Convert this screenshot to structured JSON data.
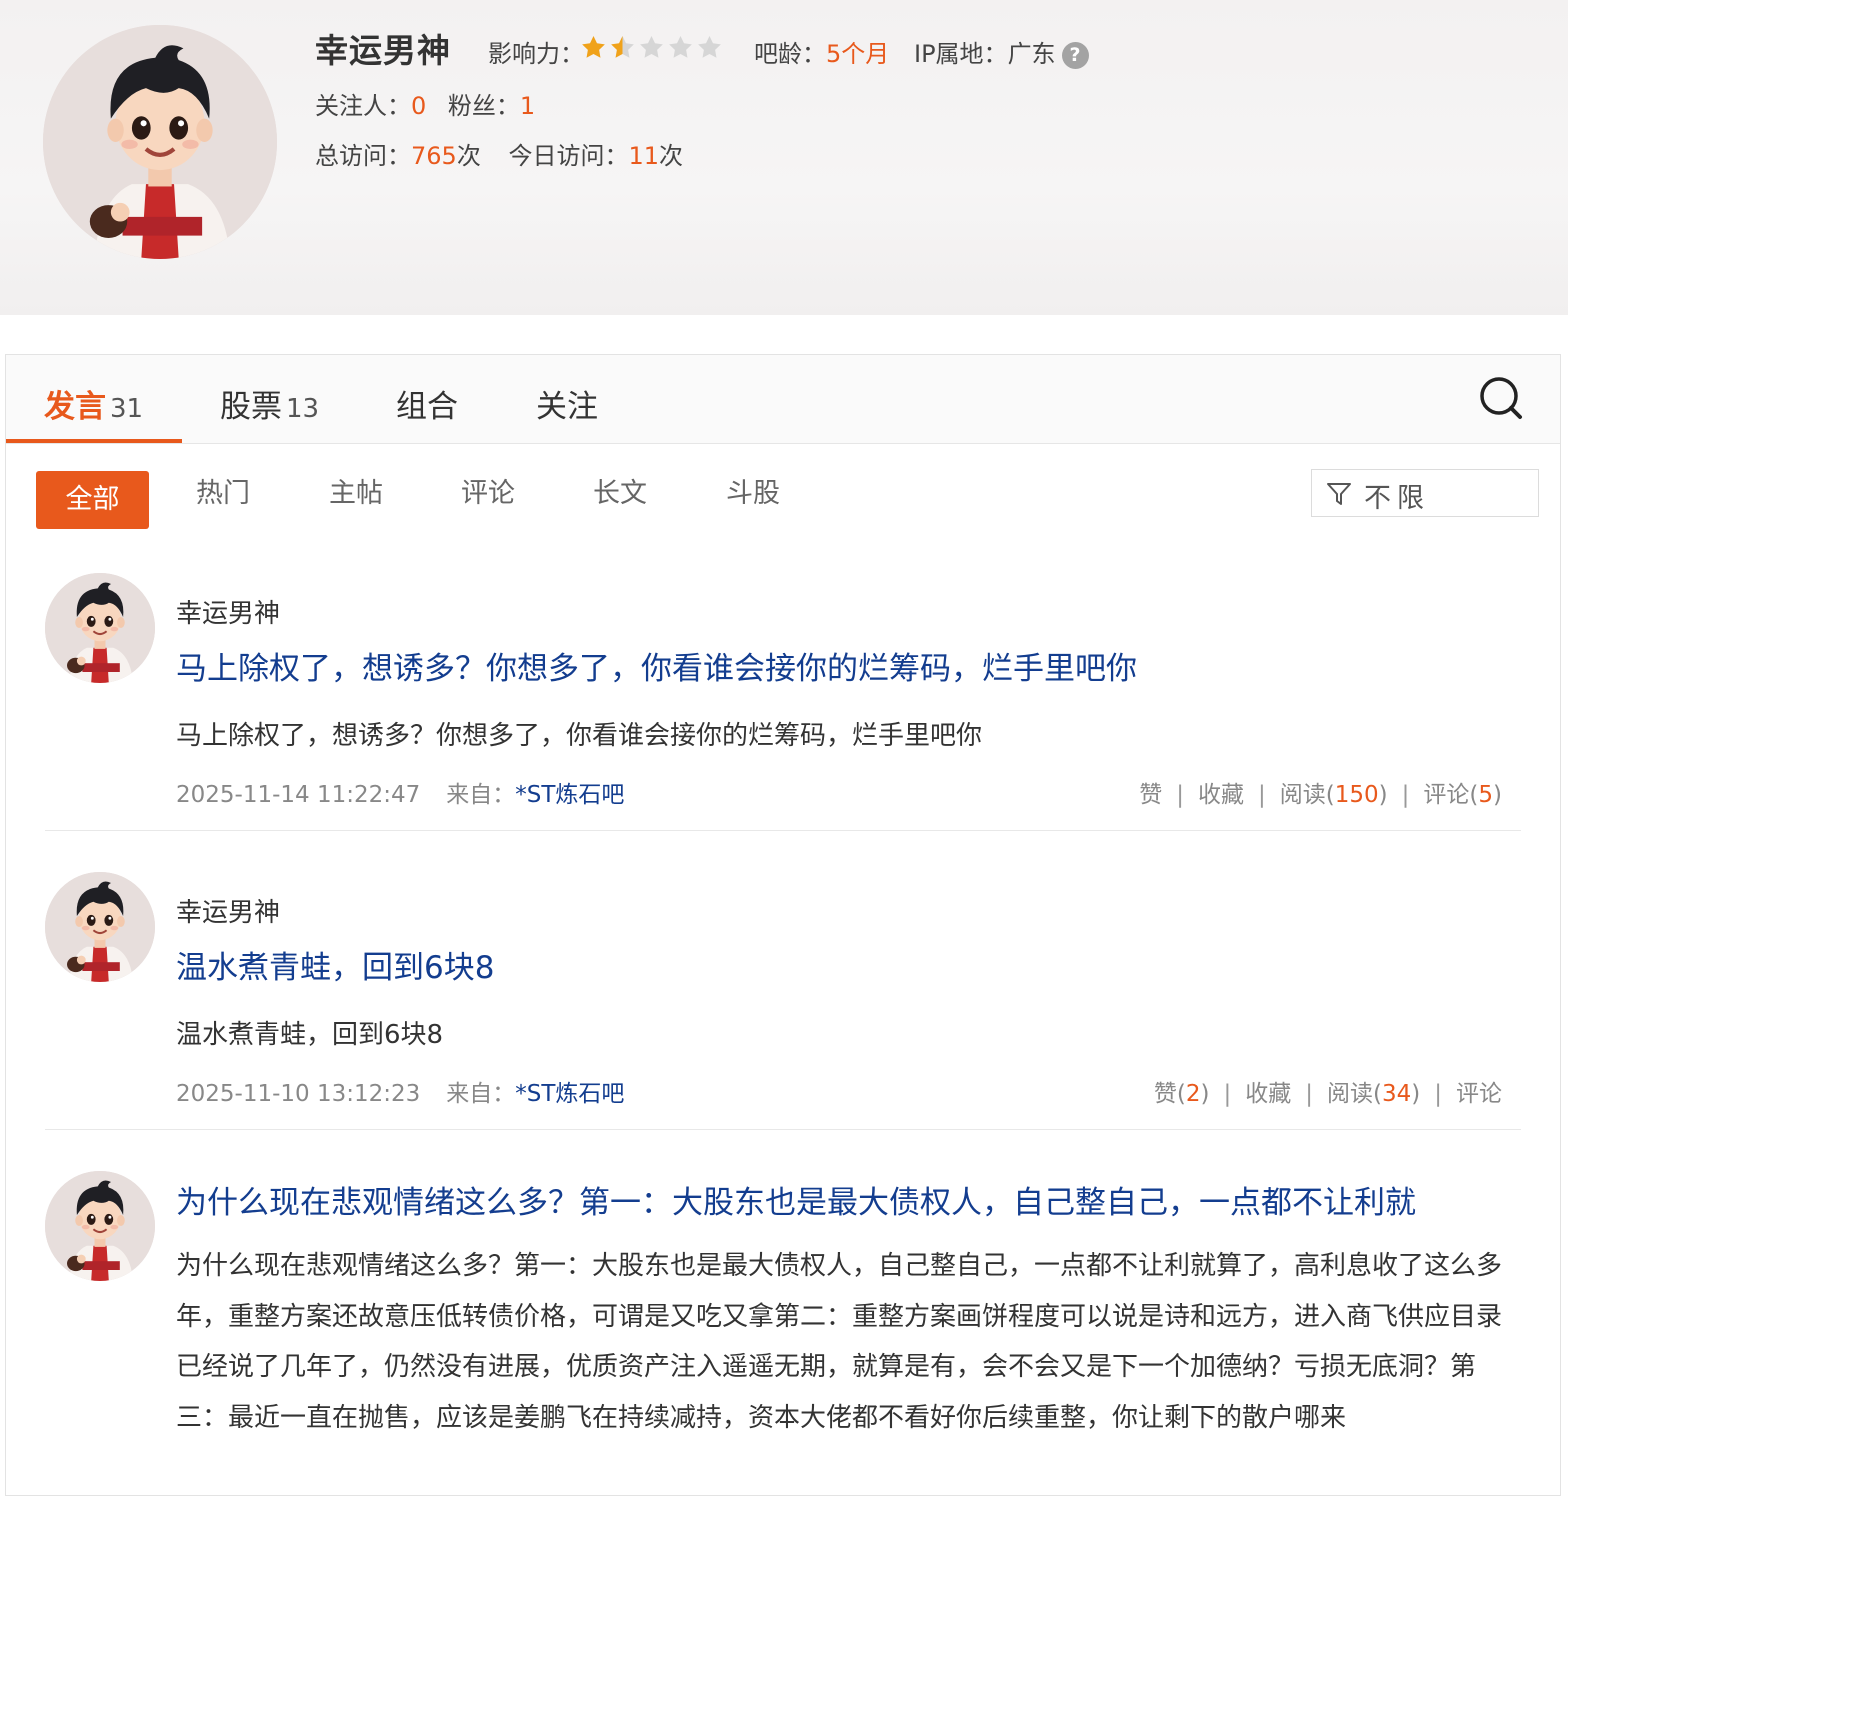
{
  "profile": {
    "name": "幸运男神",
    "influence_label": "影响力：",
    "influence_rating": 1.5,
    "influence_max": 5,
    "age_label": "吧龄：",
    "age_value": "5个月",
    "ip_label": "IP属地：",
    "ip_value": "广东",
    "help_icon": "question-icon",
    "following_label": "关注人：",
    "following_value": "0",
    "fans_label": "粉丝：",
    "fans_value": "1",
    "visits_label": "总访问：",
    "visits_value": "765",
    "visits_unit": "次",
    "today_label": "今日访问：",
    "today_value": "11",
    "today_unit": "次"
  },
  "tabs": [
    {
      "label": "发言",
      "count": "31"
    },
    {
      "label": "股票",
      "count": "13"
    },
    {
      "label": "组合",
      "count": ""
    },
    {
      "label": "关注",
      "count": ""
    }
  ],
  "filters": [
    "全部",
    "热门",
    "主帖",
    "评论",
    "长文",
    "斗股"
  ],
  "dropdown": {
    "label": "不限",
    "icon": "funnel-icon"
  },
  "colors": {
    "accent": "#e8591c",
    "link": "#133d8f"
  },
  "posts": [
    {
      "author": "幸运男神",
      "title": "马上除权了，想诱多？你想多了，你看谁会接你的烂筹码，烂手里吧你",
      "body": "马上除权了，想诱多？你想多了，你看谁会接你的烂筹码，烂手里吧你",
      "time": "2025-11-14 11:22:47",
      "from_label": "来自：",
      "from": "*ST炼石吧",
      "like": "赞",
      "like_count": "",
      "fav": "收藏",
      "read": "阅读",
      "read_count": "150",
      "comment": "评论",
      "comment_count": "5"
    },
    {
      "author": "幸运男神",
      "title": "温水煮青蛙，回到6块8",
      "body": "温水煮青蛙，回到6块8",
      "time": "2025-11-10 13:12:23",
      "from_label": "来自：",
      "from": "*ST炼石吧",
      "like": "赞",
      "like_count": "2",
      "fav": "收藏",
      "read": "阅读",
      "read_count": "34",
      "comment": "评论",
      "comment_count": ""
    },
    {
      "author": "",
      "title": "为什么现在悲观情绪这么多？第一：大股东也是最大债权人，自己整自己，一点都不让利就",
      "body": "为什么现在悲观情绪这么多？第一：大股东也是最大债权人，自己整自己，一点都不让利就算了，高利息收了这么多年，重整方案还故意压低转债价格，可谓是又吃又拿第二：重整方案画饼程度可以说是诗和远方，进入商飞供应目录已经说了几年了，仍然没有进展，优质资产注入遥遥无期，就算是有，会不会又是下一个加德纳？亏损无底洞？第三：最近一直在抛售，应该是姜鹏飞在持续减持，资本大佬都不看好你后续重整，你让剩下的散户哪来"
    }
  ]
}
